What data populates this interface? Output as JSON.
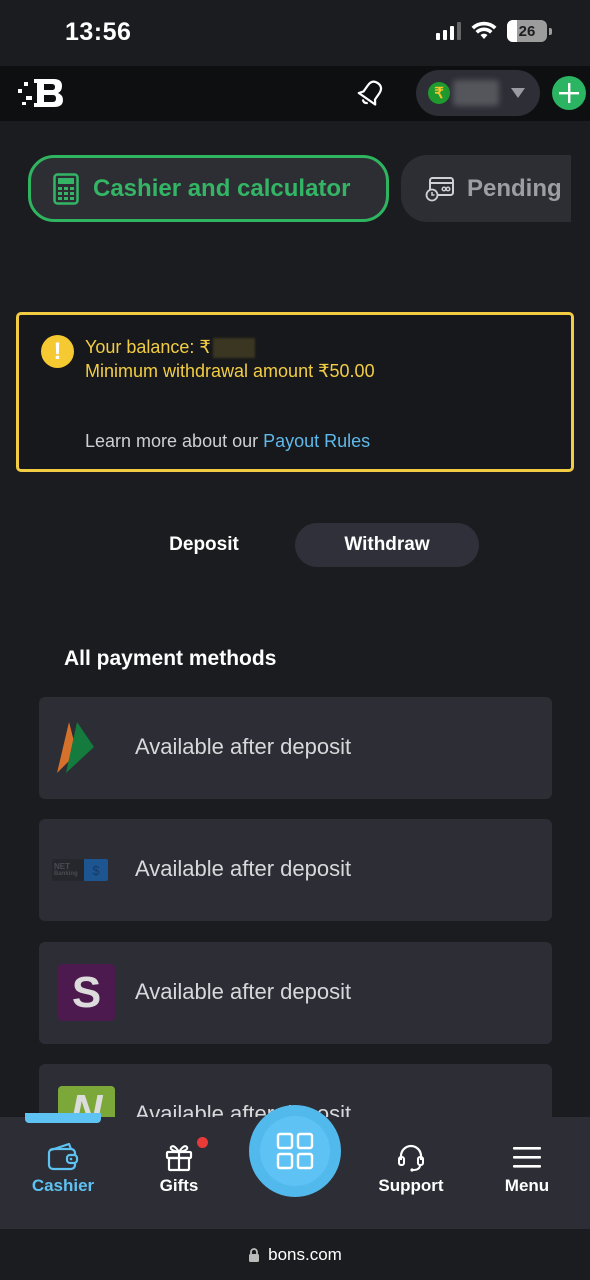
{
  "status_bar": {
    "time": "13:56",
    "battery_level": "26",
    "signal_icon": "cellular-signal-icon",
    "wifi_icon": "wifi-icon"
  },
  "topbar": {
    "logo_icon": "brand-logo-icon",
    "notifications_icon": "bell-icon",
    "currency_symbol": "₹",
    "balance_hidden": true,
    "dropdown_icon": "caret-down-icon",
    "add_funds_icon": "plus-icon"
  },
  "tabs": [
    {
      "label": "Cashier and calculator",
      "icon": "calculator-icon",
      "active": true
    },
    {
      "label": "Pending",
      "icon": "pending-card-icon",
      "active": false
    }
  ],
  "notice": {
    "icon": "warning-icon",
    "balance_label": "Your balance: ₹",
    "min_withdrawal": "Minimum withdrawal amount ₹50.00",
    "learn_more_prefix": "Learn more about our ",
    "learn_more_link": "Payout Rules"
  },
  "mode_toggle": {
    "deposit_label": "Deposit",
    "withdraw_label": "Withdraw",
    "active": "Withdraw"
  },
  "payment_methods": {
    "title": "All payment methods",
    "items": [
      {
        "logo": "upi-logo",
        "text": "Available after deposit"
      },
      {
        "logo": "net-banking-logo",
        "text": "Available after deposit",
        "logo_text_1": "NET",
        "logo_text_2": "Banking",
        "logo_symbol": "$"
      },
      {
        "logo": "skrill-logo",
        "text": "Available after deposit",
        "logo_letter": "S"
      },
      {
        "logo": "neteller-logo",
        "text": "Available after deposit",
        "logo_letter": "N"
      }
    ]
  },
  "bottom_nav": {
    "items": [
      {
        "label": "Cashier",
        "icon": "wallet-icon",
        "active": true
      },
      {
        "label": "Gifts",
        "icon": "gift-icon",
        "active": false,
        "has_badge": true
      },
      {
        "label": "Support",
        "icon": "headset-icon",
        "active": false
      },
      {
        "label": "Menu",
        "icon": "hamburger-menu-icon",
        "active": false
      }
    ],
    "center_icon": "grid-icon"
  },
  "browser": {
    "url": "bons.com",
    "lock_icon": "lock-icon"
  },
  "colors": {
    "accent_green": "#2fb460",
    "warning_yellow": "#f2cd44",
    "link_blue": "#5fb9ea",
    "nav_active_blue": "#5ec3f2",
    "background": "#1b1c20",
    "card": "#2c2d35"
  }
}
